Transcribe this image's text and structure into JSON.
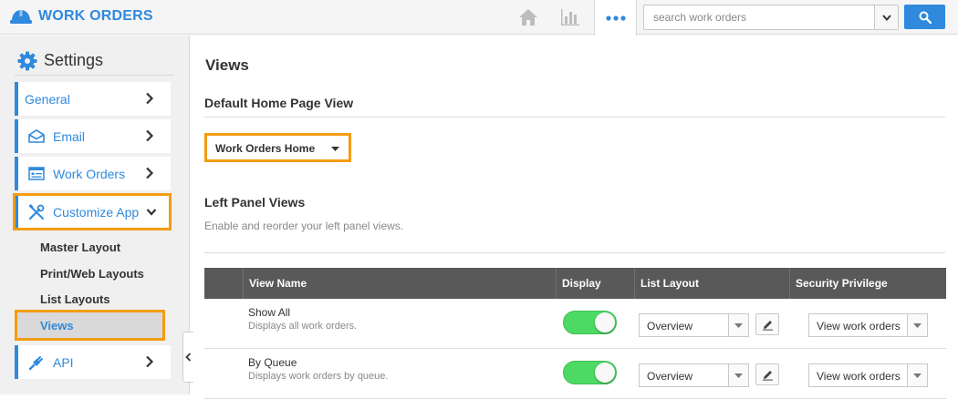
{
  "app": {
    "title": "WORK ORDERS"
  },
  "search": {
    "placeholder": "search work orders"
  },
  "sidebar": {
    "heading": "Settings",
    "items": [
      {
        "label": "General"
      },
      {
        "label": "Email"
      },
      {
        "label": "Work Orders"
      },
      {
        "label": "Customize App"
      },
      {
        "label": "API"
      }
    ],
    "subitems": [
      {
        "label": "Master Layout"
      },
      {
        "label": "Print/Web Layouts"
      },
      {
        "label": "List Layouts"
      },
      {
        "label": "Views"
      }
    ]
  },
  "main": {
    "title": "Views",
    "default_section": "Default Home Page View",
    "default_value": "Work Orders Home",
    "left_section": "Left Panel Views",
    "left_subtitle": "Enable and reorder your left panel views.",
    "columns": [
      "View Name",
      "Display",
      "List Layout",
      "Security Privilege"
    ],
    "rows": [
      {
        "name": "Show All",
        "desc": "Displays all work orders.",
        "layout": "Overview",
        "privilege": "View work orders",
        "display": true
      },
      {
        "name": "By Queue",
        "desc": "Displays work orders by queue.",
        "layout": "Overview",
        "privilege": "View work orders",
        "display": true
      }
    ]
  },
  "colors": {
    "accent": "#2f89dd",
    "highlight": "#f39c12",
    "toggle_on": "#4cd964",
    "table_header": "#595959"
  }
}
